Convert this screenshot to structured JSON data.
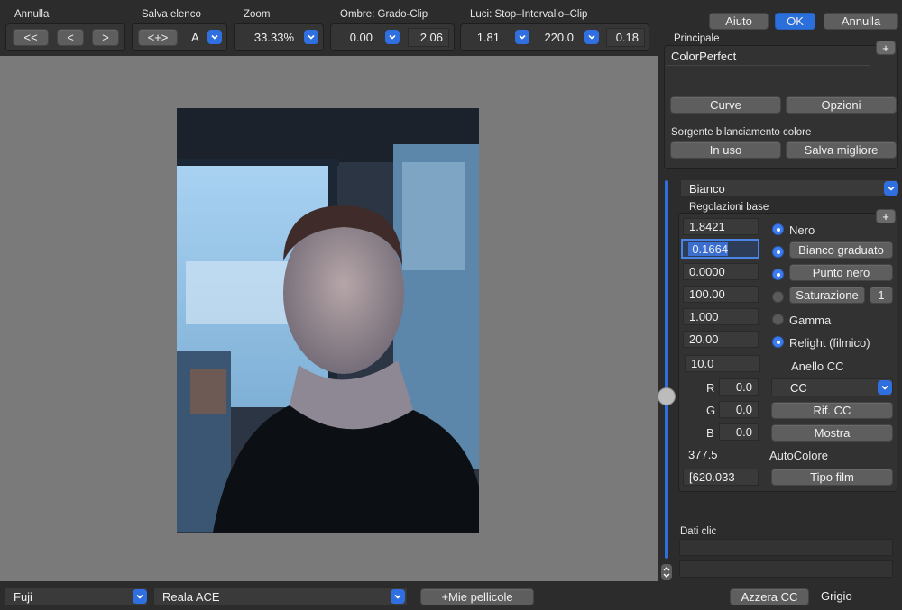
{
  "toolbar": {
    "undo_label": "Annulla",
    "undo_first": "<<",
    "undo_prev": "<",
    "undo_next": ">",
    "save_list_label": "Salva elenco",
    "save_list_btn": "<+>",
    "save_list_value": "A",
    "zoom_label": "Zoom",
    "zoom_value": "33.33%",
    "shadows_label": "Ombre: Grado-Clip",
    "shadows_grade": "0.00",
    "shadows_clip": "2.06",
    "lights_label": "Luci: Stop–Intervallo–Clip",
    "lights_stop": "1.81",
    "lights_range": "220.0",
    "lights_clip": "0.18",
    "help": "Aiuto",
    "ok": "OK",
    "cancel": "Annulla"
  },
  "principal": {
    "label": "Principale",
    "profile": "ColorPerfect",
    "curves": "Curve",
    "options": "Opzioni",
    "wb_source_label": "Sorgente bilanciamento colore",
    "in_use": "In uso",
    "save_best": "Salva migliore"
  },
  "basic": {
    "mode_value": "Bianco",
    "section_label": "Regolazioni base",
    "values": [
      "1.8421",
      "-0.1664",
      "0.0000",
      "100.00",
      "1.000",
      "20.00"
    ],
    "black": "Nero",
    "graduated_white": "Bianco graduato",
    "black_point": "Punto nero",
    "saturation": "Saturazione",
    "saturation_num": "1",
    "gamma": "Gamma",
    "relight": "Relight (filmico)",
    "cc_ring_value": "10.0",
    "cc_ring_label": "Anello CC",
    "r_label": "R",
    "r_value": "0.0",
    "g_label": "G",
    "g_value": "0.0",
    "b_label": "B",
    "b_value": "0.0",
    "cc_select": "CC",
    "ref_cc": "Rif. CC",
    "show": "Mostra",
    "autocolor_value": "377.5",
    "autocolor_label": "AutoColore",
    "film_value": "[620.033",
    "film_type": "Tipo film"
  },
  "click_data": {
    "label": "Dati clic"
  },
  "bottom": {
    "brand": "Fuji",
    "film": "Reala ACE",
    "my_films": "+Mie pellicole",
    "reset_cc": "Azzera CC",
    "gray": "Grigio"
  },
  "colors": {
    "accent": "#2f6fe0",
    "ok": "#2b6fdc",
    "canvas": "#7a7a7a"
  }
}
